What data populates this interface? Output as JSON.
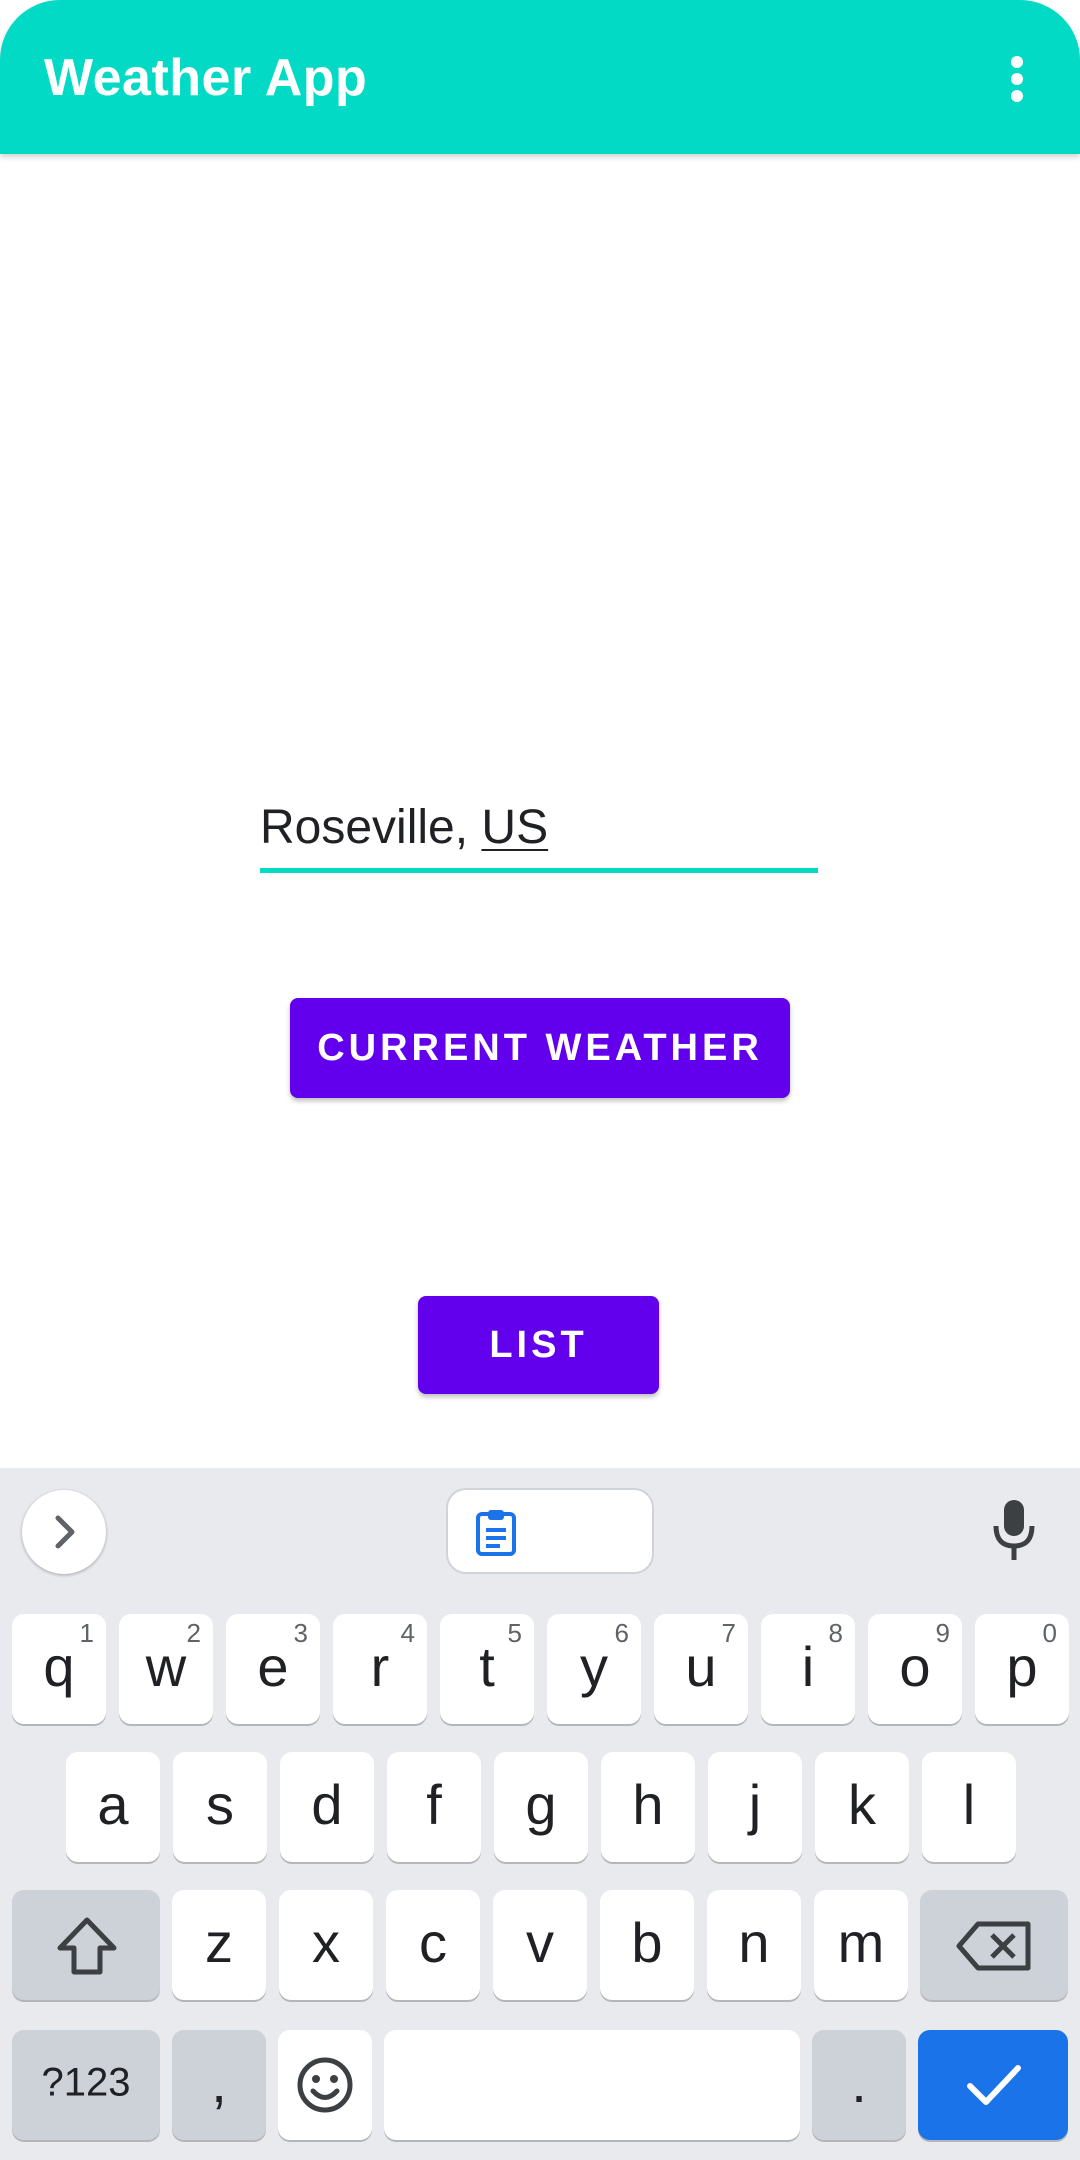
{
  "app_bar": {
    "title": "Weather App",
    "overflow_icon": "more-vert-icon",
    "color": "#03DAC5"
  },
  "city_input": {
    "value_main": "Roseville, ",
    "value_composing": "US"
  },
  "buttons": {
    "current_weather": "CURRENT WEATHER",
    "list": "LIST",
    "color": "#6200EE"
  },
  "keyboard": {
    "toolbar": {
      "expand_icon": "chevron-right-icon",
      "clipboard_icon": "clipboard-icon",
      "mic_icon": "mic-icon"
    },
    "row1": [
      {
        "k": "q",
        "h": "1"
      },
      {
        "k": "w",
        "h": "2"
      },
      {
        "k": "e",
        "h": "3"
      },
      {
        "k": "r",
        "h": "4"
      },
      {
        "k": "t",
        "h": "5"
      },
      {
        "k": "y",
        "h": "6"
      },
      {
        "k": "u",
        "h": "7"
      },
      {
        "k": "i",
        "h": "8"
      },
      {
        "k": "o",
        "h": "9"
      },
      {
        "k": "p",
        "h": "0"
      }
    ],
    "row2": [
      "a",
      "s",
      "d",
      "f",
      "g",
      "h",
      "j",
      "k",
      "l"
    ],
    "row3": [
      "z",
      "x",
      "c",
      "v",
      "b",
      "n",
      "m"
    ],
    "symbols_label": "?123",
    "comma": ",",
    "period": ".",
    "shift_icon": "shift-icon",
    "backspace_icon": "backspace-icon",
    "emoji_icon": "emoji-icon",
    "enter_icon": "check-icon",
    "enter_color": "#1A73E8"
  }
}
